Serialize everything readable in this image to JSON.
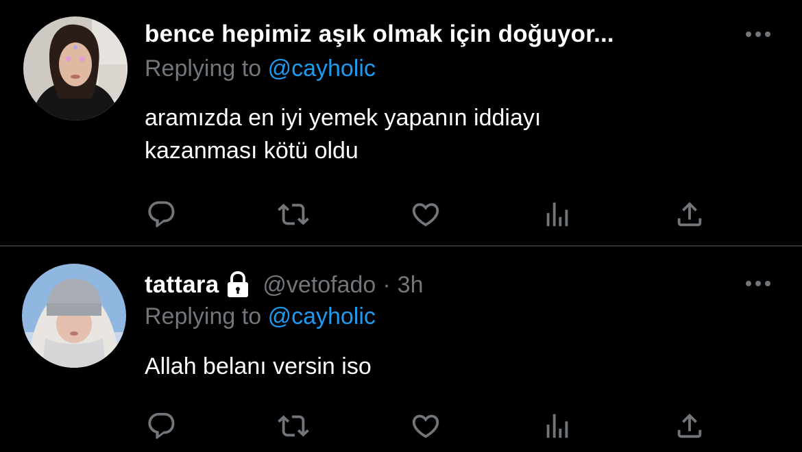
{
  "colors": {
    "background": "#000000",
    "primary_text": "#ffffff",
    "secondary_text": "#71767b",
    "link": "#1d9bf0",
    "divider": "#2f3336"
  },
  "tweets": [
    {
      "display_name": "bence hepimiz aşık olmak için doğuyor...",
      "replying_prefix": "Replying to",
      "replying_handle": "@cayholic",
      "text_line_1": "aramızda en iyi yemek yapanın iddiayı",
      "text_line_2": "kazanması kötü oldu",
      "avatar_icon": "profile-photo",
      "more_icon": "more-dots-icon",
      "actions": [
        "reply-icon",
        "retweet-icon",
        "like-icon",
        "analytics-icon",
        "share-icon"
      ]
    },
    {
      "display_name": "tattara",
      "protected_icon": "lock-icon",
      "handle": "@vetofado",
      "separator": "·",
      "time": "3h",
      "replying_prefix": "Replying to",
      "replying_handle": "@cayholic",
      "text_line_1": "Allah belanı versin iso",
      "avatar_icon": "profile-photo",
      "more_icon": "more-dots-icon",
      "actions": [
        "reply-icon",
        "retweet-icon",
        "like-icon",
        "analytics-icon",
        "share-icon"
      ]
    }
  ]
}
